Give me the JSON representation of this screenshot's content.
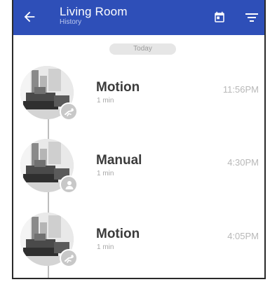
{
  "header": {
    "title": "Living Room",
    "subtitle": "History",
    "back_icon": "arrow-left-icon",
    "calendar_icon": "calendar-icon",
    "filter_icon": "filter-icon"
  },
  "date_chip": "Today",
  "events": [
    {
      "type": "Motion",
      "duration": "1 min",
      "time": "11:56PM",
      "badge_icon": "motion-icon"
    },
    {
      "type": "Manual",
      "duration": "1 min",
      "time": "4:30PM",
      "badge_icon": "person-icon"
    },
    {
      "type": "Motion",
      "duration": "1 min",
      "time": "4:05PM",
      "badge_icon": "motion-icon"
    }
  ],
  "colors": {
    "appbar": "#2e4fb8",
    "title": "#ffffff",
    "subtitle": "#bcc8ef",
    "event_type": "#3b3b3b",
    "muted": "#a8a8a8"
  }
}
